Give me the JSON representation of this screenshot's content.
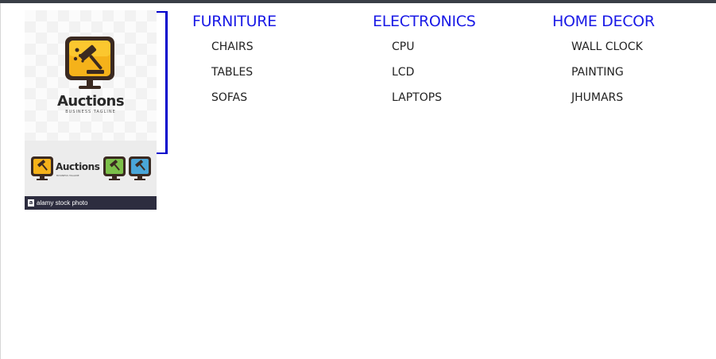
{
  "logo": {
    "title": "Auctions",
    "tagline": "BUSINESS TAGLINE",
    "variant_title": "Auctions",
    "variant_tagline": "BUSINESS TAGLINE",
    "watermark_mark": "a",
    "watermark_text": "alamy stock photo"
  },
  "menu": {
    "columns": [
      {
        "heading": "FURNITURE",
        "items": [
          "CHAIRS",
          "TABLES",
          "SOFAS"
        ]
      },
      {
        "heading": "ELECTRONICS",
        "items": [
          "CPU",
          "LCD",
          "LAPTOPS"
        ]
      },
      {
        "heading": "HOME DECOR",
        "items": [
          "WALL CLOCK",
          "PAINTING",
          "JHUMARS"
        ]
      }
    ]
  },
  "colors": {
    "heading": "#1a1ae6",
    "item": "#222222",
    "bracket": "#0000cc",
    "topbar": "#3a3f47"
  }
}
